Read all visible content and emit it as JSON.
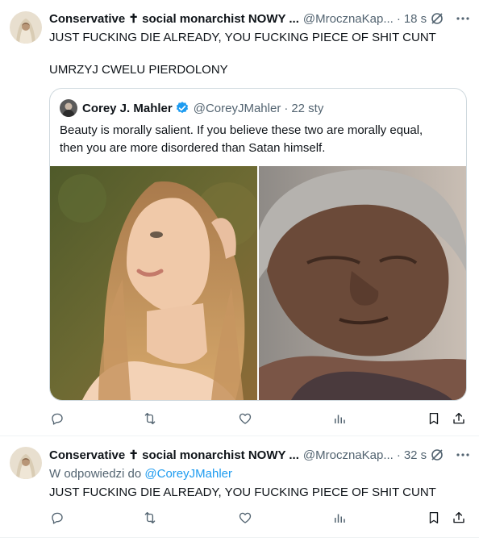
{
  "posts": [
    {
      "author_name": "Conservative ✝ social monarchist NOWY ...",
      "handle": "@MrocznaKap...",
      "time": "18 s",
      "text_lines": [
        "JUST FUCKING DIE ALREADY, YOU FUCKING PIECE OF SHIT CUNT",
        "UMRZYJ CWELU PIERDOLONY"
      ],
      "quote": {
        "author_name": "Corey J. Mahler",
        "handle": "@CoreyJMahler",
        "time": "22 sty",
        "text_lines": [
          "Beauty is morally salient. If you believe these two are morally equal,",
          "then you are more disordered than Satan himself."
        ]
      }
    },
    {
      "author_name": "Conservative ✝ social monarchist NOWY ...",
      "handle": "@MrocznaKap...",
      "time": "32 s",
      "reply_prefix": "W odpowiedzi do",
      "reply_handle": "@CoreyJMahler",
      "text": "JUST FUCKING DIE ALREADY, YOU FUCKING PIECE OF SHIT CUNT"
    }
  ],
  "separator": "·",
  "icons": {
    "grok": "grok-slash-icon",
    "more": "more-dots-icon",
    "reply": "reply-bubble-icon",
    "repost": "repost-arrows-icon",
    "like": "heart-icon",
    "views": "views-bars-icon",
    "bookmark": "bookmark-icon",
    "share": "share-upload-icon"
  },
  "colors": {
    "text": "#0f1419",
    "muted": "#536471",
    "link": "#1d9bf0",
    "border": "#cfd9de",
    "divider": "#eff3f4",
    "verified": "#1d9bf0"
  }
}
